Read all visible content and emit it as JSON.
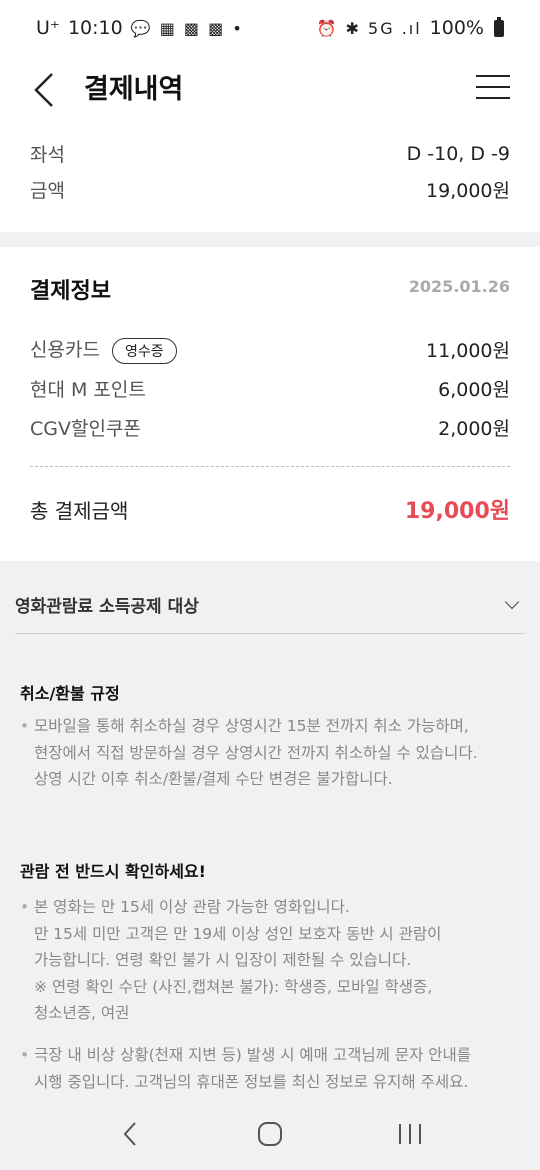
{
  "status": {
    "carrier": "U⁺",
    "time": "10:10",
    "notifications": "💬 ▦ ▩ ▩ •",
    "right_icons": "⏰ ✱ 5G .ıl",
    "battery": "100%"
  },
  "header": {
    "title": "결제내역"
  },
  "booking": {
    "seat_label": "좌석",
    "seat_value": "D -10, D -9",
    "amount_label": "금액",
    "amount_value": "19,000원"
  },
  "payment": {
    "title": "결제정보",
    "date": "2025.01.26",
    "receipt_label": "영수증",
    "items": [
      {
        "label": "신용카드",
        "value": "11,000원"
      },
      {
        "label": "현대 M 포인트",
        "value": "6,000원"
      },
      {
        "label": "CGV할인쿠폰",
        "value": "2,000원"
      }
    ],
    "total_label": "총 결제금액",
    "total_value": "19,000원"
  },
  "accordion": {
    "title": "영화관람료 소득공제 대상"
  },
  "refund": {
    "title": "취소/환불 규정",
    "lines": [
      "모바일을 통해 취소하실 경우 상영시간 15분 전까지 취소 가능하며,",
      "현장에서 직접 방문하실 경우 상영시간 전까지 취소하실 수 있습니다.",
      "상영 시간 이후 취소/환불/결제 수단 변경은 불가합니다."
    ]
  },
  "check": {
    "title": "관람 전 반드시 확인하세요!",
    "notice1": [
      "본 영화는 만 15세 이상 관람 가능한 영화입니다.",
      "만 15세 미만 고객은 만 19세 이상 성인 보호자 동반 시 관람이",
      "가능합니다. 연령 확인 불가 시 입장이 제한될 수 있습니다.",
      "※ 연령 확인 수단 (사진,캡쳐본 불가): 학생증, 모바일 학생증,",
      "청소년증, 여권"
    ],
    "notice2": [
      "극장 내 비상 상황(천재 지변 등) 발생 시 예매 고객님께 문자 안내를",
      "시행 중입니다. 고객님의 휴대폰 정보를 최신 정보로 유지해 주세요."
    ]
  },
  "colors": {
    "accent": "#e94b56",
    "background": "#f1f1f1"
  }
}
